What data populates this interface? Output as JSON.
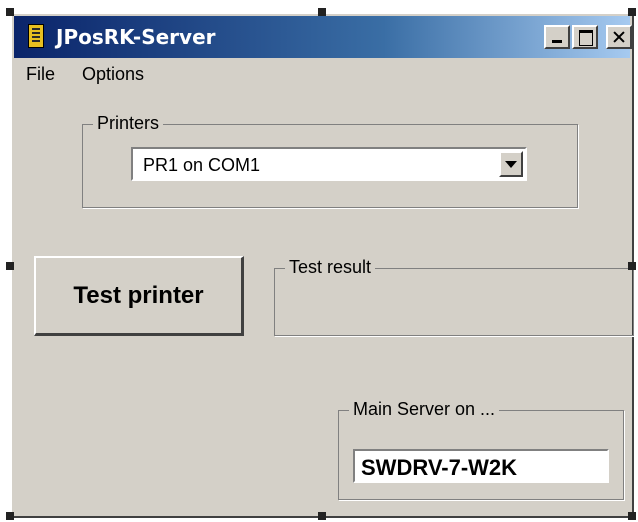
{
  "window": {
    "title": "JPosRK-Server",
    "title_gradient": [
      "#0a246a",
      "#a6caf0"
    ],
    "background": "#d4d0c8"
  },
  "menubar": {
    "items": [
      {
        "label": "File"
      },
      {
        "label": "Options"
      }
    ]
  },
  "printers": {
    "group_label": "Printers",
    "selected": "PR1 on COM1"
  },
  "test_button": {
    "label": "Test printer"
  },
  "test_result": {
    "group_label": "Test result",
    "value": ""
  },
  "main_server": {
    "group_label": "Main Server on ...",
    "value": "SWDRV-7-W2K"
  }
}
